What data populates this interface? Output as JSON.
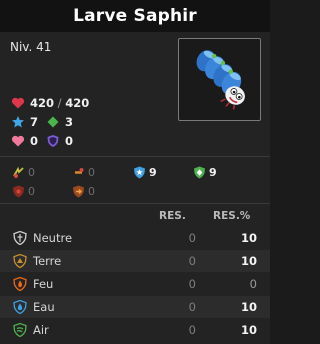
{
  "title": "Larve Saphir",
  "level": "Niv. 41",
  "stats": {
    "hp_current": "420",
    "hp_sep": " / ",
    "hp_max": "420",
    "ap": "7",
    "mp": "3",
    "heal_value": "0",
    "shield_value": "0"
  },
  "grid": {
    "row1": [
      "0",
      "0",
      "9",
      "9"
    ],
    "row2": [
      "0",
      "0"
    ]
  },
  "resistances": {
    "col_fixed": "RES.",
    "col_percent": "RES.%",
    "rows": [
      {
        "name": "Neutre",
        "fixed": "0",
        "percent": "10"
      },
      {
        "name": "Terre",
        "fixed": "0",
        "percent": "10"
      },
      {
        "name": "Feu",
        "fixed": "0",
        "percent": "0"
      },
      {
        "name": "Eau",
        "fixed": "0",
        "percent": "10"
      },
      {
        "name": "Air",
        "fixed": "0",
        "percent": "10"
      }
    ]
  },
  "colors": {
    "heart": "#e0364b",
    "ap_star": "#3fa7e8",
    "mp_diamond": "#4bb54b",
    "shield": "#7b5bd6",
    "neutral": "#cfcfcf",
    "earth": "#c9902a",
    "fire": "#e86a1a",
    "water": "#3f9fe0",
    "air": "#4fb04f"
  },
  "icons": {
    "hp": "heart-icon",
    "ap": "star-icon",
    "mp": "diamond-icon",
    "heal": "pink-heart-icon",
    "shield": "shield-icon",
    "neutre": "neutral-shield-icon",
    "terre": "earth-shield-icon",
    "feu": "fire-shield-icon",
    "eau": "water-shield-icon",
    "air": "air-shield-icon"
  }
}
